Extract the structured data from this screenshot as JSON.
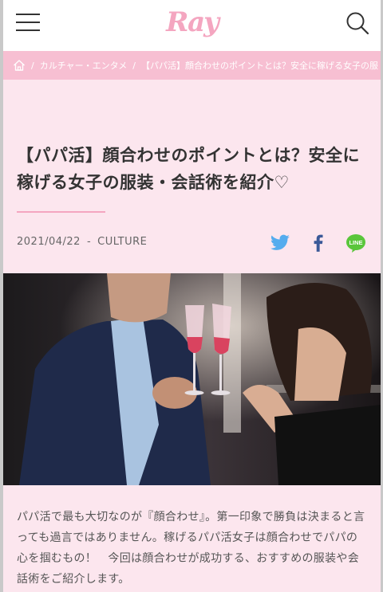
{
  "header": {
    "logo": "Ray",
    "menu_icon": "hamburger-icon",
    "search_icon": "search-icon"
  },
  "breadcrumb": {
    "home_icon": "home-icon",
    "category": "カルチャー・エンタメ",
    "current": "【パパ活】顔合わせのポイントとは？安全に稼げる女子の服"
  },
  "article": {
    "title": "【パパ活】顔合わせのポイントとは？安全に稼げる女子の服装・会話術を紹介♡",
    "date": "2021/04/22",
    "separator": "-",
    "category": "CULTURE",
    "share": {
      "twitter_icon": "twitter-icon",
      "facebook_icon": "facebook-icon",
      "line_label": "LINE"
    },
    "lead": "パパ活で最も大切なのが『顔合わせ』。第一印象で勝負は決まると言っても過言ではありません。稼げるパパ活女子は顔合わせでパパの心を掴むもの！　今回は顔合わせが成功する、おすすめの服装や会話術をご紹介します。"
  },
  "colors": {
    "brand_pink": "#f4a6c0",
    "breadcrumb_bg": "#f7bfd2",
    "page_bg": "#fce6ee",
    "twitter": "#55acee",
    "facebook": "#3b5998",
    "line": "#5ac63b"
  }
}
